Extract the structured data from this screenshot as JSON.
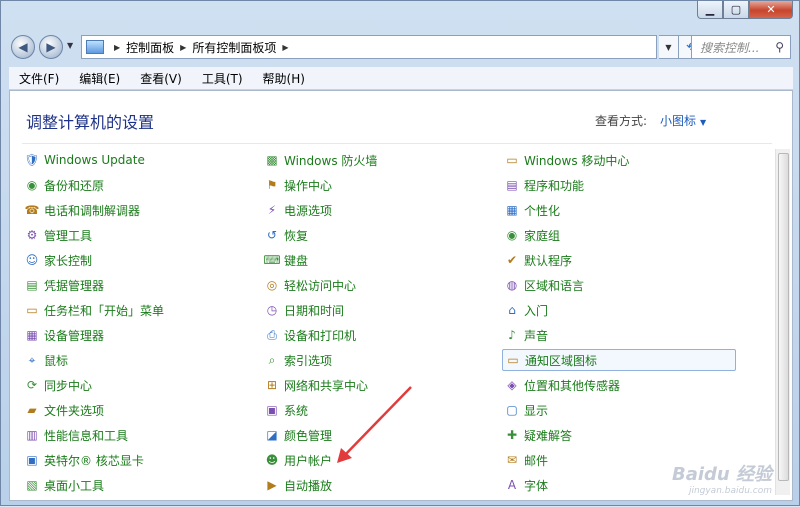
{
  "nav": {
    "breadcrumb": [
      "控制面板",
      "所有控制面板项"
    ],
    "search_placeholder": "搜索控制..."
  },
  "menu": [
    "文件(F)",
    "编辑(E)",
    "查看(V)",
    "工具(T)",
    "帮助(H)"
  ],
  "header": {
    "title": "调整计算机的设置",
    "view_by_label": "查看方式:",
    "view_by_value": "小图标"
  },
  "columns": [
    [
      "Windows Update",
      "备份和还原",
      "电话和调制解调器",
      "管理工具",
      "家长控制",
      "凭据管理器",
      "任务栏和「开始」菜单",
      "设备管理器",
      "鼠标",
      "同步中心",
      "文件夹选项",
      "性能信息和工具",
      "英特尔® 核芯显卡",
      "桌面小工具"
    ],
    [
      "Windows 防火墙",
      "操作中心",
      "电源选项",
      "恢复",
      "键盘",
      "轻松访问中心",
      "日期和时间",
      "设备和打印机",
      "索引选项",
      "网络和共享中心",
      "系统",
      "颜色管理",
      "用户帐户",
      "自动播放"
    ],
    [
      "Windows 移动中心",
      "程序和功能",
      "个性化",
      "家庭组",
      "默认程序",
      "区域和语言",
      "入门",
      "声音",
      "通知区域图标",
      "位置和其他传感器",
      "显示",
      "疑难解答",
      "邮件",
      "字体"
    ]
  ],
  "icons": [
    [
      "shield-icon",
      "backup-icon",
      "phone-icon",
      "tools-icon",
      "family-icon",
      "credential-icon",
      "taskbar-icon",
      "device-icon",
      "mouse-icon",
      "sync-icon",
      "folder-icon",
      "performance-icon",
      "intel-icon",
      "gadget-icon"
    ],
    [
      "firewall-icon",
      "flag-icon",
      "power-icon",
      "restore-icon",
      "keyboard-icon",
      "access-icon",
      "clock-icon",
      "printer-icon",
      "index-icon",
      "network-icon",
      "system-icon",
      "color-icon",
      "users-icon",
      "autoplay-icon"
    ],
    [
      "mobility-icon",
      "programs-icon",
      "personalize-icon",
      "homegroup-icon",
      "default-icon",
      "globe-icon",
      "start-icon",
      "sound-icon",
      "tray-icon",
      "sensor-icon",
      "display-icon",
      "troubleshoot-icon",
      "mail-icon",
      "font-icon"
    ]
  ],
  "highlighted_item": "通知区域图标",
  "watermark": {
    "brand": "Baidu 经验",
    "url": "jingyan.baidu.com"
  },
  "colors": {
    "link": "#1a7b1a",
    "title": "#1e3287",
    "arrow": "#e23b3b"
  }
}
